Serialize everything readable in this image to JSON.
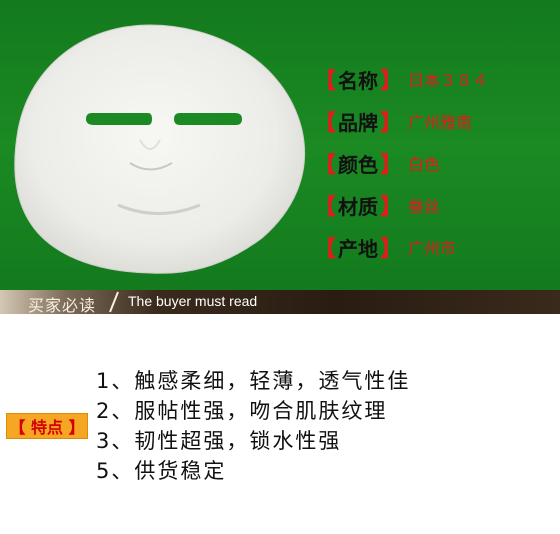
{
  "colors": {
    "background_green": "#1b8a23",
    "accent_red": "#e31b1b",
    "tag_orange": "#f5a623",
    "banner_dark": "#2a1c12"
  },
  "product_image": {
    "icon": "face-mask-image"
  },
  "specs": {
    "open_bracket": "【",
    "close_bracket": "】",
    "items": [
      {
        "label": "名称",
        "value": "日本３８４"
      },
      {
        "label": "品牌",
        "value": "广州雅南"
      },
      {
        "label": "颜色",
        "value": "白色"
      },
      {
        "label": "材质",
        "value": "蚕丝"
      },
      {
        "label": "产地",
        "value": "广州市"
      }
    ]
  },
  "banner": {
    "cn": "买家必读",
    "en": "The buyer must read"
  },
  "features": {
    "tag": "【 特点 】",
    "items": [
      "1、触感柔细，轻薄，透气性佳",
      "2、服帖性强，吻合肌肤纹理",
      "3、韧性超强，锁水性强",
      "5、供货稳定"
    ]
  }
}
